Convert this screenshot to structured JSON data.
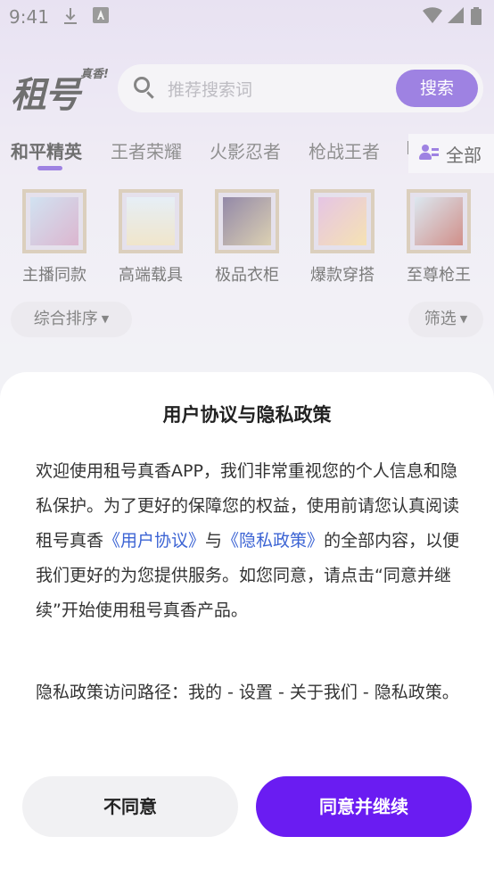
{
  "status_bar": {
    "time": "9:41",
    "download_icon": "download-icon",
    "notification_icon": "font-a-icon",
    "wifi_icon": "wifi-icon",
    "signal_icon": "signal-icon",
    "battery_icon": "battery-icon"
  },
  "header": {
    "logo_main": "租号",
    "logo_sub": "真香!",
    "search_placeholder": "推荐搜索词",
    "search_button": "搜索"
  },
  "tabs": [
    {
      "label": "和平精英",
      "active": true
    },
    {
      "label": "王者荣耀",
      "active": false
    },
    {
      "label": "火影忍者",
      "active": false
    },
    {
      "label": "枪战王者",
      "active": false
    },
    {
      "label": "B",
      "active": false
    }
  ],
  "all_button": "全部",
  "categories": [
    {
      "label": "主播同款"
    },
    {
      "label": "高端载具"
    },
    {
      "label": "极品衣柜"
    },
    {
      "label": "爆款穿搭"
    },
    {
      "label": "至尊枪王"
    }
  ],
  "filters": {
    "sort_label": "综合排序",
    "filter_label": "筛选"
  },
  "dialog": {
    "title": "用户协议与隐私政策",
    "body_prefix": "欢迎使用租号真香APP，我们非常重视您的个人信息和隐私保护。为了更好的保障您的权益，使用前请您认真阅读租号真香",
    "user_agreement_link": "《用户协议》",
    "and_text": "与",
    "privacy_link": "《隐私政策》",
    "body_suffix": "的全部内容，以便我们更好的为您提供服务。如您同意，请点击“同意并继续”开始使用租号真香产品。",
    "path_text": "隐私政策访问路径：我的 - 设置 - 关于我们 - 隐私政策。",
    "disagree_button": "不同意",
    "agree_button": "同意并继续"
  },
  "colors": {
    "accent": "#6a1cf2",
    "link": "#3c64d4"
  }
}
